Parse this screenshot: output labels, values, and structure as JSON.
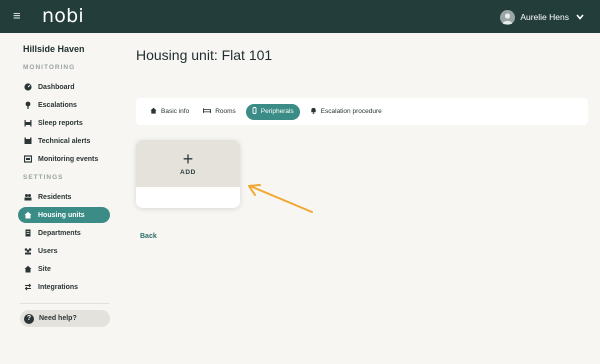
{
  "topbar": {
    "logo": "nobi",
    "user_name": "Aurelie Hens",
    "menu_icon": "hamburger-icon",
    "avatar_icon": "user-avatar-icon"
  },
  "sidebar": {
    "org_name": "Hillside Haven",
    "monitoring_label": "MONITORING",
    "monitoring_items": [
      {
        "label": "Dashboard",
        "icon": "dashboard-icon"
      },
      {
        "label": "Escalations",
        "icon": "pin-icon"
      },
      {
        "label": "Sleep reports",
        "icon": "bed-icon"
      },
      {
        "label": "Technical alerts",
        "icon": "alert-icon"
      },
      {
        "label": "Monitoring events",
        "icon": "monitor-icon"
      }
    ],
    "settings_label": "SETTINGS",
    "settings_items": [
      {
        "label": "Residents",
        "icon": "people-icon"
      },
      {
        "label": "Housing units",
        "icon": "home-icon",
        "active": true
      },
      {
        "label": "Departments",
        "icon": "building-icon"
      },
      {
        "label": "Users",
        "icon": "users-icon"
      },
      {
        "label": "Site",
        "icon": "house-icon"
      },
      {
        "label": "Integrations",
        "icon": "swap-icon"
      }
    ],
    "help_label": "Need help?"
  },
  "main": {
    "title": "Housing unit: Flat 101",
    "tabs": [
      {
        "label": "Basic info",
        "icon": "home-icon"
      },
      {
        "label": "Rooms",
        "icon": "bed-icon"
      },
      {
        "label": "Peripherals",
        "icon": "peripheral-icon",
        "active": true
      },
      {
        "label": "Escalation procedure",
        "icon": "bell-icon"
      }
    ],
    "add_label": "ADD",
    "back_label": "Back"
  },
  "colors": {
    "topbar": "#233d3b",
    "accent": "#3b8c86",
    "arrow": "#f2a830"
  }
}
